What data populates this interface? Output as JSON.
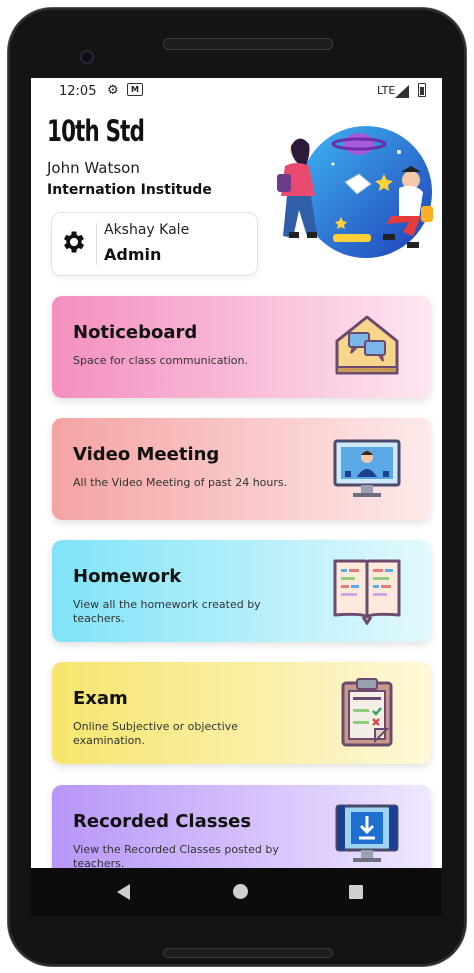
{
  "status_bar": {
    "time": "12:05",
    "network": "LTE",
    "icons": [
      "settings-icon",
      "mail-icon",
      "signal-icon",
      "battery-icon"
    ]
  },
  "header": {
    "grade": "10th Std",
    "user_name": "John Watson",
    "institute": "Internation Institude"
  },
  "profile": {
    "name": "Akshay Kale",
    "role": "Admin",
    "icon": "gear-icon"
  },
  "cards": [
    {
      "title": "Noticeboard",
      "description": "Space for class communication.",
      "icon": "noticeboard-icon",
      "gradient": [
        "#f48fbf",
        "#fde6f1"
      ]
    },
    {
      "title": "Video Meeting",
      "description": "All the Video Meeting of past 24 hours.",
      "icon": "video-meeting-icon",
      "gradient": [
        "#f5a3a3",
        "#fdeaea"
      ]
    },
    {
      "title": "Homework",
      "description": "View all the homework created by teachers.",
      "icon": "homework-book-icon",
      "gradient": [
        "#7fe3f7",
        "#e3f9fd"
      ]
    },
    {
      "title": "Exam",
      "description": "Online Subjective or objective examination.",
      "icon": "exam-clipboard-icon",
      "gradient": [
        "#f6e56d",
        "#fdf8d8"
      ]
    },
    {
      "title": "Recorded Classes",
      "description": "View the Recorded Classes posted by teachers.",
      "icon": "recorded-classes-icon",
      "gradient": [
        "#b896f8",
        "#efe7fe"
      ]
    }
  ],
  "nav": {
    "icons": [
      "back-icon",
      "home-icon",
      "recents-icon"
    ]
  }
}
